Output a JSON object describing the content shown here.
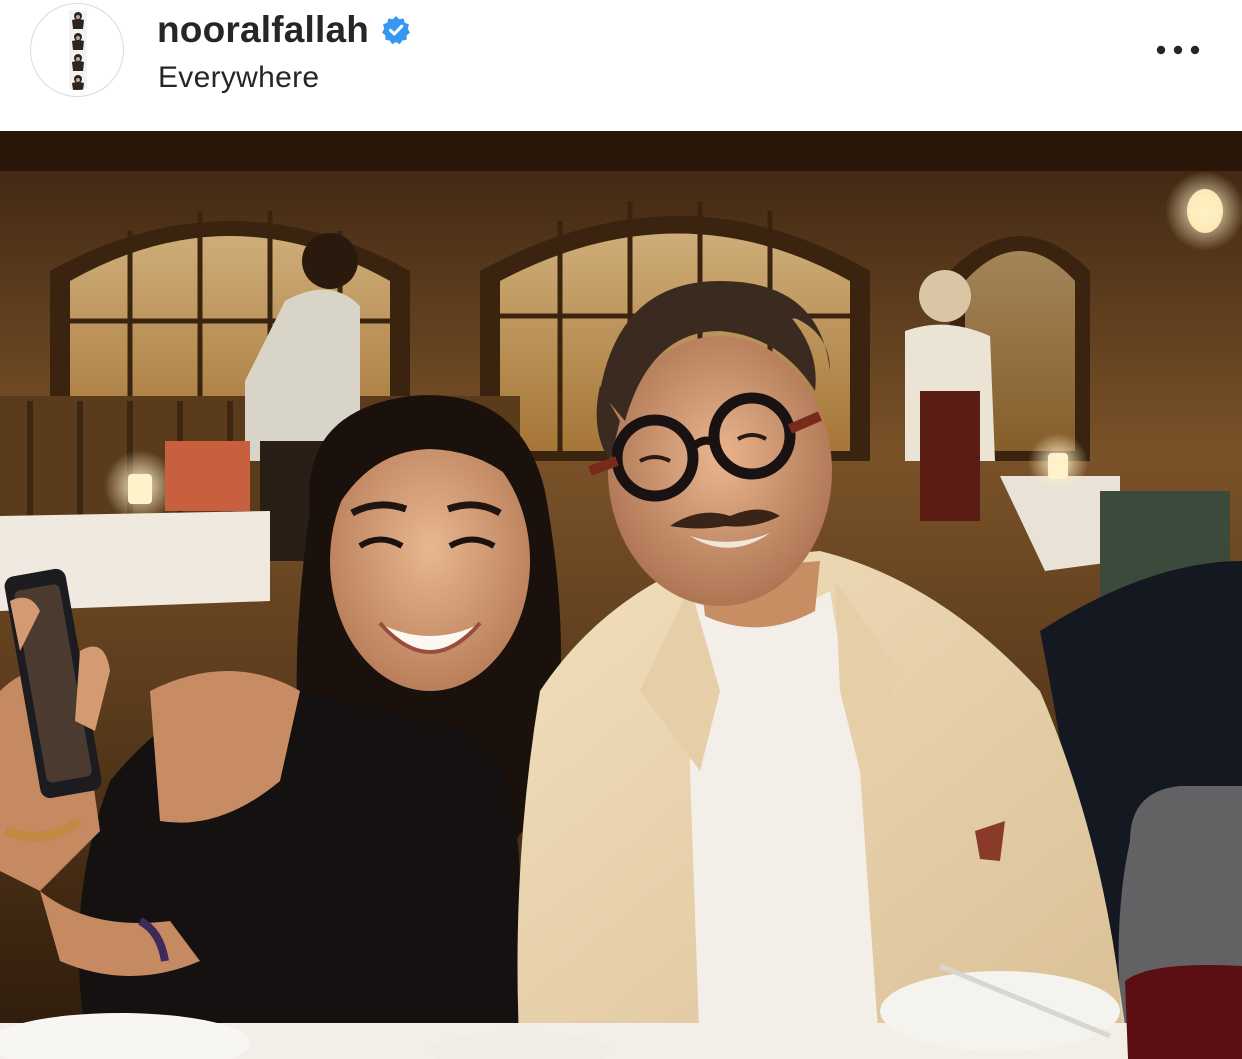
{
  "post": {
    "username": "nooralfallah",
    "location": "Everywhere",
    "verified": true,
    "verified_color": "#3897f0"
  },
  "icons": {
    "verified": "verified-badge-icon",
    "more": "more-options-icon"
  },
  "photo": {
    "description_kind": "photo-content"
  }
}
